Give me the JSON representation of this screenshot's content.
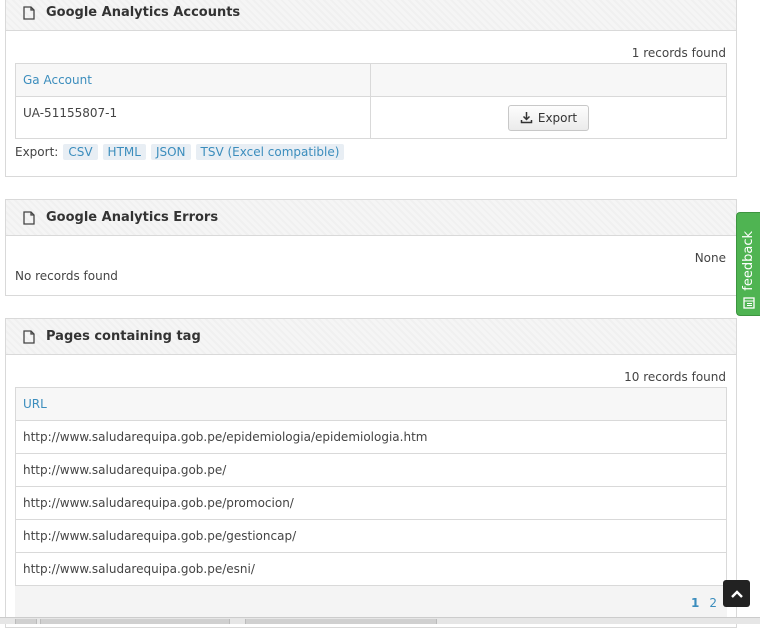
{
  "accounts": {
    "title": "Google Analytics Accounts",
    "count": "1 records found",
    "columns": [
      "Ga Account",
      ""
    ],
    "rows": [
      {
        "account": "UA-51155807-1",
        "action": "Export"
      }
    ],
    "export_label": "Export:",
    "export_formats": [
      "CSV",
      "HTML",
      "JSON",
      "TSV (Excel compatible)"
    ]
  },
  "errors": {
    "title": "Google Analytics Errors",
    "status": "None",
    "empty": "No records found"
  },
  "pages": {
    "title": "Pages containing tag",
    "count": "10 records found",
    "column": "URL",
    "rows": [
      "http://www.saludarequipa.gob.pe/epidemiologia/epidemiologia.htm",
      "http://www.saludarequipa.gob.pe/",
      "http://www.saludarequipa.gob.pe/promocion/",
      "http://www.saludarequipa.gob.pe/gestioncap/",
      "http://www.saludarequipa.gob.pe/esni/"
    ],
    "pagination": [
      "1",
      "2"
    ]
  },
  "feedback": {
    "label": "feedback"
  },
  "colors": {
    "link": "#3b8dbd",
    "feedback": "#4fb452"
  },
  "icons": [
    "document-icon",
    "download-icon",
    "feedback-icon",
    "chevron-up-icon"
  ]
}
